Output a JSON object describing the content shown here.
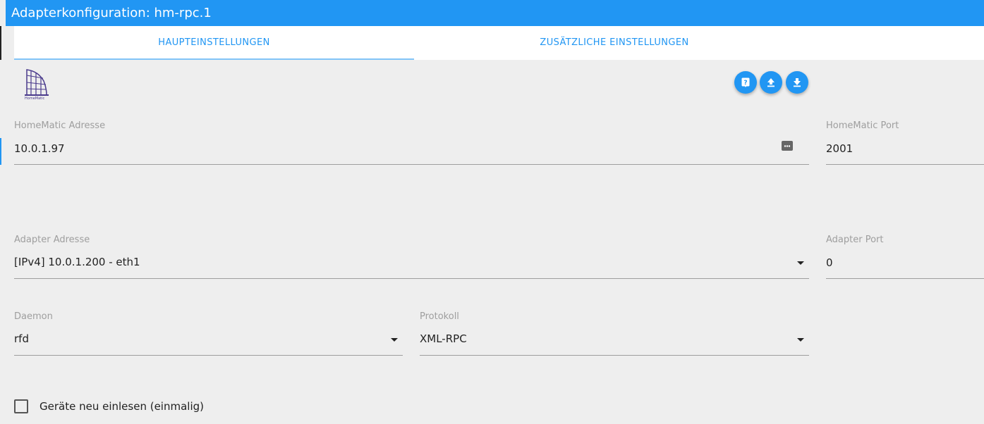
{
  "window": {
    "title": "Adapterkonfiguration: hm-rpc.1"
  },
  "tabs": [
    {
      "label": "HAUPTEINSTELLUNGEN",
      "active": true
    },
    {
      "label": "ZUSÄTZLICHE EINSTELLUNGEN",
      "active": false
    }
  ],
  "toolbar": {
    "help_icon": "help-icon",
    "upload_icon": "upload-icon",
    "download_icon": "download-icon"
  },
  "form": {
    "homematic_address": {
      "label": "HomeMatic Adresse",
      "value": "10.0.1.97"
    },
    "homematic_port": {
      "label": "HomeMatic Port",
      "value": "2001"
    },
    "adapter_address": {
      "label": "Adapter Adresse",
      "value": "[IPv4] 10.0.1.200 - eth1"
    },
    "adapter_port": {
      "label": "Adapter Port",
      "value": "0"
    },
    "daemon": {
      "label": "Daemon",
      "value": "rfd"
    },
    "protocol": {
      "label": "Protokoll",
      "value": "XML-RPC"
    },
    "reread_devices": {
      "label": "Geräte neu einlesen (einmalig)",
      "checked": false
    }
  },
  "colors": {
    "accent": "#2196f3",
    "background": "#eeeeee",
    "label": "#9e9e9e"
  }
}
